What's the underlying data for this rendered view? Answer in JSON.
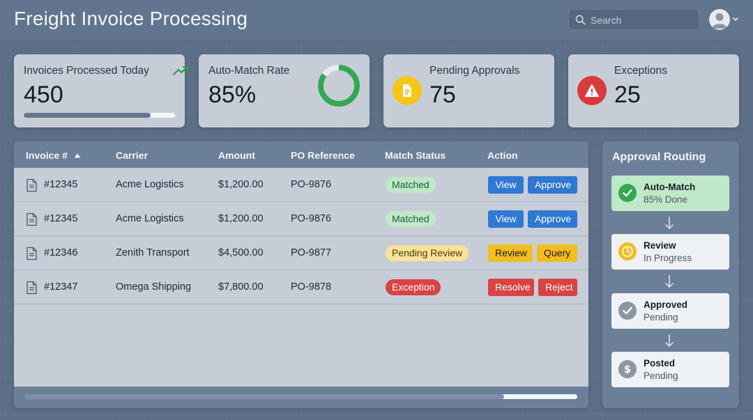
{
  "header": {
    "title": "Freight Invoice Processing",
    "search_placeholder": "Search"
  },
  "kpis": {
    "invoices": {
      "label": "Invoices Processed Today",
      "value": "450",
      "progress": 0.84,
      "icon": "trend-up-icon"
    },
    "automatch": {
      "label": "Auto-Match Rate",
      "value": "85%",
      "ring_fill": 0.85,
      "icon": "donut-ring"
    },
    "pending": {
      "label": "Pending Approvals",
      "value": "75",
      "icon": "document-icon",
      "color": "#f5c518"
    },
    "exceptions": {
      "label": "Exceptions",
      "value": "25",
      "icon": "warning-icon",
      "color": "#d93a3a"
    }
  },
  "table": {
    "columns": {
      "invoice": "Invoice #",
      "carrier": "Carrier",
      "amount": "Amount",
      "po": "PO Reference",
      "status": "Match Status",
      "action": "Action"
    },
    "rows": [
      {
        "invoice": "#12345",
        "carrier": "Acme Logistics",
        "amount": "$1,200.00",
        "po": "PO-9876",
        "status": "Matched",
        "status_type": "matched",
        "actions": [
          "View",
          "Approve"
        ]
      },
      {
        "invoice": "#12345",
        "carrier": "Acme Logistics",
        "amount": "$1,200.00",
        "po": "PO-9876",
        "status": "Matched",
        "status_type": "matched",
        "actions": [
          "View",
          "Approve"
        ]
      },
      {
        "invoice": "#12346",
        "carrier": "Zenith Transport",
        "amount": "$4,500.00",
        "po": "PO-9877",
        "status": "Pending Review",
        "status_type": "pending",
        "actions": [
          "Review",
          "Query"
        ]
      },
      {
        "invoice": "#12347",
        "carrier": "Omega Shipping",
        "amount": "$7,800.00",
        "po": "PO-9878",
        "status": "Exception",
        "status_type": "exception",
        "actions": [
          "Resolve",
          "Reject"
        ]
      }
    ]
  },
  "routing": {
    "title": "Approval Routing",
    "steps": [
      {
        "title": "Auto-Match",
        "sub": "85% Done",
        "icon": "check-circle-icon",
        "state": "done"
      },
      {
        "title": "Review",
        "sub": "In Progress",
        "icon": "clock-icon",
        "state": "active"
      },
      {
        "title": "Approved",
        "sub": "Pending",
        "icon": "check-circle-icon",
        "state": "pending"
      },
      {
        "title": "Posted",
        "sub": "Pending",
        "icon": "dollar-icon",
        "state": "pending"
      }
    ]
  },
  "colors": {
    "matched_bg": "#bfe8c9",
    "pending_bg": "#f8e39a",
    "exception_bg": "#d94343",
    "blue": "#2f78d3",
    "yellow": "#f2bd1e",
    "red": "#d94343",
    "green": "#33a853"
  }
}
